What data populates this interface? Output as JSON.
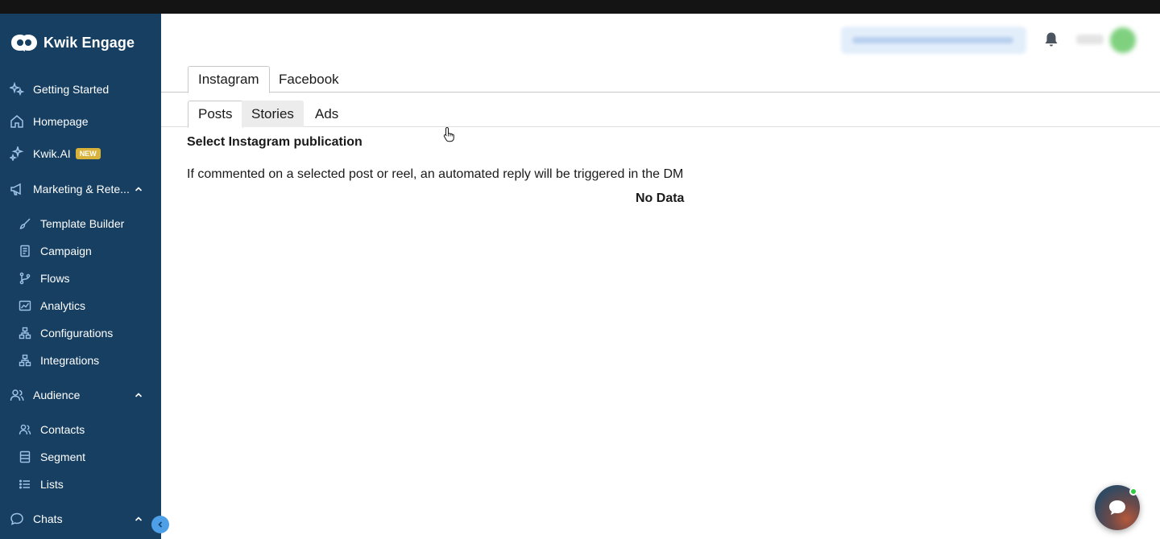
{
  "app": {
    "brand": "Kwik Engage"
  },
  "sidebar": {
    "items": [
      {
        "label": "Getting Started",
        "icon": "sparkle-icon"
      },
      {
        "label": "Homepage",
        "icon": "home-icon"
      },
      {
        "label": "Kwik.AI",
        "icon": "ai-sparkle-icon",
        "badge": "NEW"
      },
      {
        "label": "Marketing & Rete...",
        "icon": "megaphone-icon",
        "expanded": true
      },
      {
        "label": "Template Builder",
        "icon": "brush-icon"
      },
      {
        "label": "Campaign",
        "icon": "campaign-doc-icon"
      },
      {
        "label": "Flows",
        "icon": "branch-icon"
      },
      {
        "label": "Analytics",
        "icon": "chart-icon"
      },
      {
        "label": "Configurations",
        "icon": "network-icon"
      },
      {
        "label": "Integrations",
        "icon": "network-icon"
      },
      {
        "label": "Audience",
        "icon": "users-icon",
        "expanded": true
      },
      {
        "label": "Contacts",
        "icon": "users-icon"
      },
      {
        "label": "Segment",
        "icon": "segment-icon"
      },
      {
        "label": "Lists",
        "icon": "list-icon"
      },
      {
        "label": "Chats",
        "icon": "chat-icon",
        "expanded": true
      }
    ]
  },
  "platform_tabs": [
    {
      "label": "Instagram",
      "active": true
    },
    {
      "label": "Facebook",
      "active": false
    }
  ],
  "content_tabs": [
    {
      "label": "Posts",
      "active": true
    },
    {
      "label": "Stories",
      "active": false,
      "hovered": true
    },
    {
      "label": "Ads",
      "active": false
    }
  ],
  "main": {
    "section_title": "Select Instagram publication",
    "description": "If commented on a selected post or reel, an automated reply will be triggered in the DM",
    "empty_state": "No Data"
  },
  "colors": {
    "sidebar_bg": "#163f62",
    "accent": "#4d9fe8",
    "badge": "#d9b23a",
    "online": "#2ecc40"
  }
}
